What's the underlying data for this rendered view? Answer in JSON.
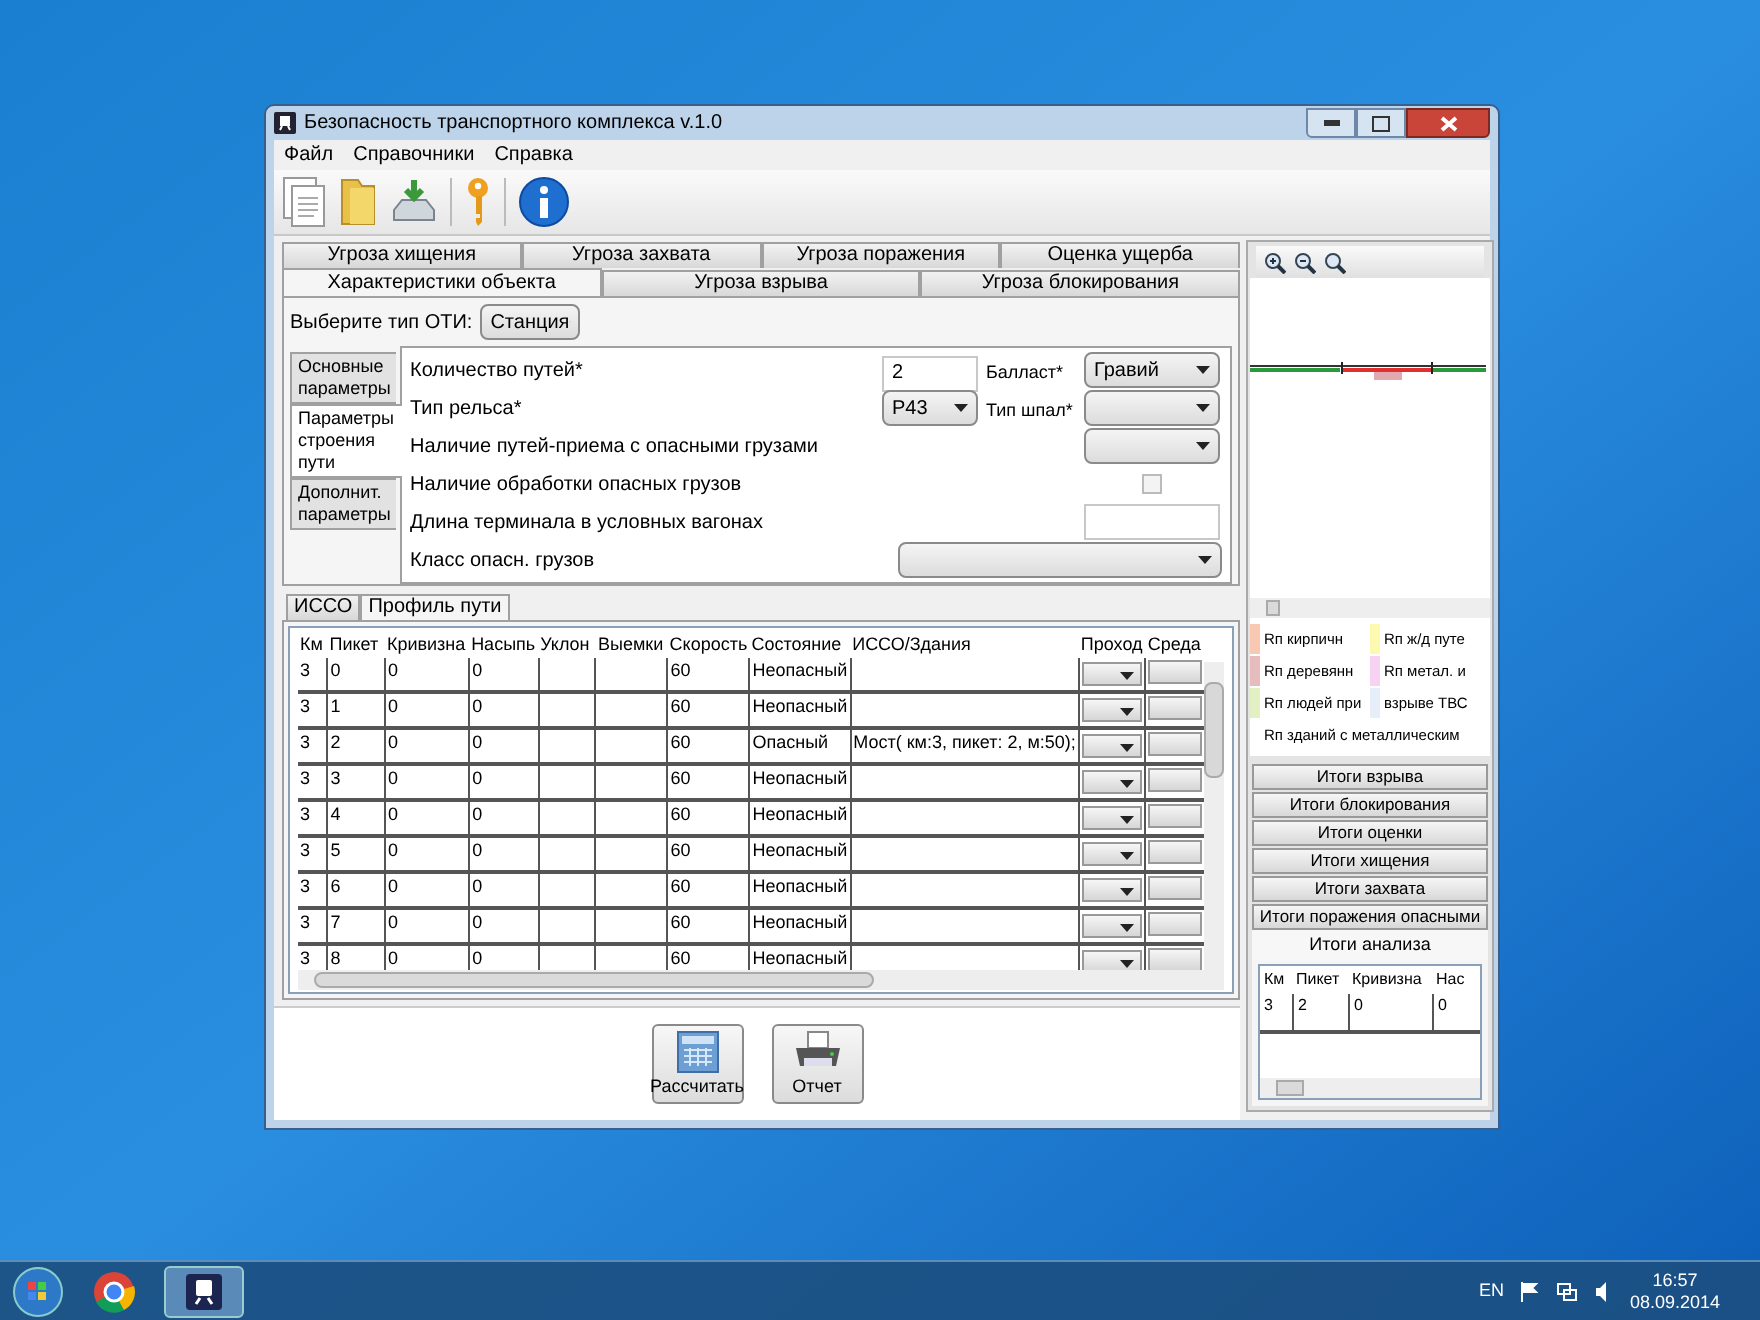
{
  "window": {
    "title": "Безопасность транспортного комплекса v.1.0"
  },
  "menu": [
    "Файл",
    "Справочники",
    "Справка"
  ],
  "top_tabs": [
    [
      {
        "label": "Угроза хищения",
        "selected": false
      },
      {
        "label": "Угроза захвата",
        "selected": false
      },
      {
        "label": "Угроза поражения",
        "selected": false
      },
      {
        "label": "Оценка ущерба",
        "selected": false
      }
    ],
    [
      {
        "label": "Характеристики объекта",
        "selected": true
      },
      {
        "label": "Угроза взрыва",
        "selected": false
      },
      {
        "label": "Угроза блокирования",
        "selected": false
      }
    ]
  ],
  "oti": {
    "label": "Выберите тип ОТИ:",
    "value": "Станция"
  },
  "side_tabs": [
    {
      "label": "Основные параметры",
      "selected": false
    },
    {
      "label": "Параметры строения пути",
      "selected": true
    },
    {
      "label": "Дополнит. параметры",
      "selected": false
    }
  ],
  "form_rows": [
    {
      "label": "Количество путей*",
      "mid": {
        "kind": "input",
        "value": "2"
      },
      "right_label": "Балласт*",
      "right": {
        "kind": "select",
        "value": "Гравий"
      }
    },
    {
      "label": "Тип рельса*",
      "mid": {
        "kind": "select",
        "value": "Р43"
      },
      "right_label": "Тип шпал*",
      "right": {
        "kind": "select"
      }
    },
    {
      "label": "Наличие путей-приема с опасными грузами",
      "right": {
        "kind": "select"
      }
    },
    {
      "label": "Наличие обработки опасных грузов",
      "right": {
        "kind": "checkbox",
        "checked": false
      }
    },
    {
      "label": "Длина терминала в условных вагонах",
      "right": {
        "kind": "input"
      }
    },
    {
      "label": "Класс опасн. грузов",
      "wide": {
        "kind": "select"
      }
    }
  ],
  "bottom_tabs": [
    {
      "label": "ИССО",
      "selected": false
    },
    {
      "label": "Профиль пути",
      "selected": true
    }
  ],
  "table": {
    "columns": [
      "Км",
      "Пикет",
      "Кривизна",
      "Насыпь",
      "Уклон",
      "Выемки",
      "Скорость",
      "Состояние",
      "ИССО/Здания",
      "Проход",
      "Среда"
    ],
    "rows": [
      [
        "3",
        "0",
        "0",
        "0",
        "",
        "",
        "60",
        "Неопасный",
        ""
      ],
      [
        "3",
        "1",
        "0",
        "0",
        "",
        "",
        "60",
        "Неопасный",
        ""
      ],
      [
        "3",
        "2",
        "0",
        "0",
        "",
        "",
        "60",
        "Опасный",
        "Мост( км:3, пикет: 2, м:50);"
      ],
      [
        "3",
        "3",
        "0",
        "0",
        "",
        "",
        "60",
        "Неопасный",
        ""
      ],
      [
        "3",
        "4",
        "0",
        "0",
        "",
        "",
        "60",
        "Неопасный",
        ""
      ],
      [
        "3",
        "5",
        "0",
        "0",
        "",
        "",
        "60",
        "Неопасный",
        ""
      ],
      [
        "3",
        "6",
        "0",
        "0",
        "",
        "",
        "60",
        "Неопасный",
        ""
      ],
      [
        "3",
        "7",
        "0",
        "0",
        "",
        "",
        "60",
        "Неопасный",
        ""
      ],
      [
        "3",
        "8",
        "0",
        "0",
        "",
        "",
        "60",
        "Неопасный",
        ""
      ]
    ]
  },
  "actions": [
    {
      "kind": "calc",
      "label": "Рассчитать"
    },
    {
      "kind": "print",
      "label": "Отчет"
    }
  ],
  "legend": [
    {
      "label": "Rп кирпичн",
      "color": "#f9c8b2"
    },
    {
      "label": "Rп ж/д путе",
      "color": "#fdf9b0"
    },
    {
      "label": "Rп деревянн",
      "color": "#e6bcbc"
    },
    {
      "label": "Rп метал. и",
      "color": "#f8d2f2"
    },
    {
      "label": "Rп людей при",
      "color": "#e2f0c4"
    },
    {
      "label": "взрыве ТВС",
      "color": "#e6eff9"
    },
    {
      "label": "Rп зданий с металлическим"
    }
  ],
  "result_buttons": [
    "Итоги взрыва",
    "Итоги блокирования",
    "Итоги оценки",
    "Итоги хищения",
    "Итоги захвата",
    "Итоги поражения опасными"
  ],
  "result_tab": {
    "label": "Итоги анализа",
    "selected": true
  },
  "result_table": {
    "columns": [
      "Км",
      "Пикет",
      "Кривизна",
      "Нас"
    ],
    "rows": [
      [
        "3",
        "2",
        "0",
        "0"
      ]
    ]
  },
  "taskbar": {
    "language": "EN",
    "time": "16:57",
    "date": "08.09.2014"
  }
}
